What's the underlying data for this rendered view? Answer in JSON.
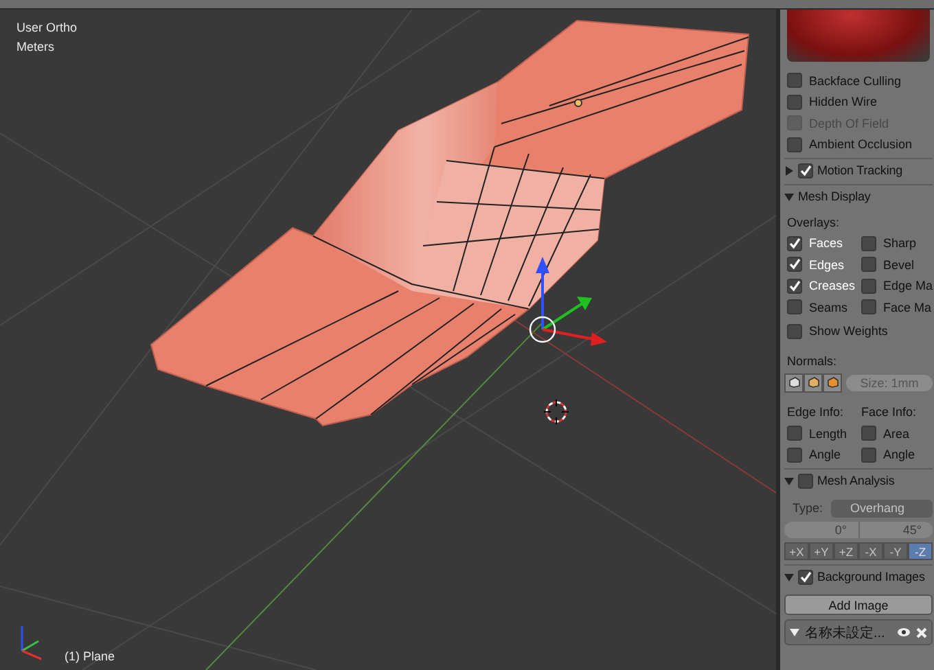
{
  "viewport": {
    "view_name": "User Ortho",
    "units": "Meters",
    "object_label": "(1) Plane"
  },
  "sidebar": {
    "display_options": [
      {
        "label": "Backface Culling",
        "checked": false,
        "disabled": false
      },
      {
        "label": "Hidden Wire",
        "checked": false,
        "disabled": false
      },
      {
        "label": "Depth Of Field",
        "checked": false,
        "disabled": true
      },
      {
        "label": "Ambient Occlusion",
        "checked": false,
        "disabled": false
      }
    ],
    "motion_tracking": {
      "title": "Motion Tracking",
      "expanded": false,
      "enabled": true
    },
    "mesh_display": {
      "title": "Mesh Display",
      "expanded": true,
      "overlays_label": "Overlays:",
      "overlays": [
        {
          "label": "Faces",
          "checked": true
        },
        {
          "label": "Sharp",
          "checked": false
        },
        {
          "label": "Edges",
          "checked": true
        },
        {
          "label": "Bevel",
          "checked": false
        },
        {
          "label": "Creases",
          "checked": true
        },
        {
          "label": "Edge Ma",
          "checked": false
        },
        {
          "label": "Seams",
          "checked": false
        },
        {
          "label": "Face Ma",
          "checked": false
        }
      ],
      "show_weights": {
        "label": "Show Weights",
        "checked": false
      },
      "normals_label": "Normals:",
      "normals_size": "Size: 1mm",
      "edge_info_label": "Edge Info:",
      "face_info_label": "Face Info:",
      "info_options": [
        {
          "label": "Length",
          "checked": false
        },
        {
          "label": "Area",
          "checked": false
        },
        {
          "label": "Angle",
          "checked": false
        },
        {
          "label": "Angle",
          "checked": false
        }
      ]
    },
    "mesh_analysis": {
      "title": "Mesh Analysis",
      "expanded": true,
      "enabled": false,
      "type_label": "Type:",
      "type_value": "Overhang",
      "min": "0°",
      "max": "45°",
      "axes": [
        {
          "label": "+X",
          "selected": false
        },
        {
          "label": "+Y",
          "selected": false
        },
        {
          "label": "+Z",
          "selected": false
        },
        {
          "label": "-X",
          "selected": false
        },
        {
          "label": "-Y",
          "selected": false
        },
        {
          "label": "-Z",
          "selected": true
        }
      ]
    },
    "background_images": {
      "title": "Background Images",
      "expanded": true,
      "enabled": true,
      "add_button": "Add Image",
      "images": [
        {
          "name": "名称未設定...",
          "expanded": true
        }
      ]
    }
  }
}
